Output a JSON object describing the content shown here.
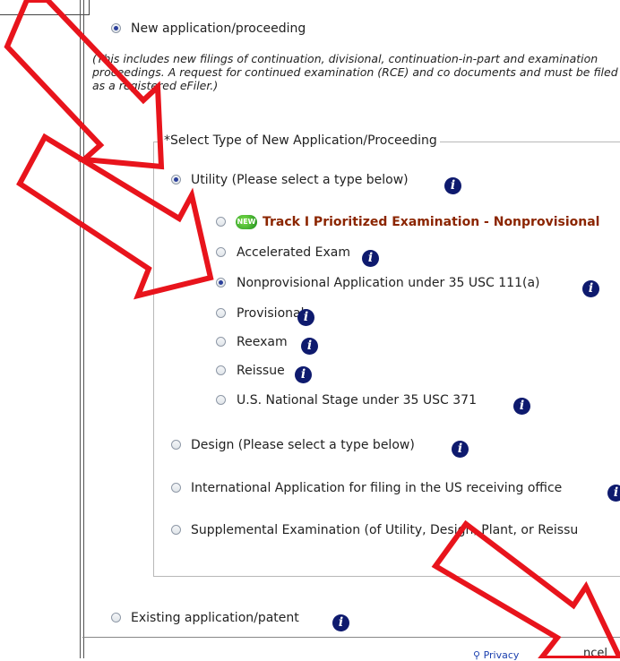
{
  "application": {
    "new_label": "New application/proceeding",
    "note": "(This includes new filings of continuation, divisional, continuation-in-part and examination proceedings. A request for continued examination (RCE) and co documents and must be filed as a registered eFiler.)",
    "type_legend": "*Select Type of New Application/Proceeding",
    "utility_label": "Utility (Please select a type below)",
    "utility_types": [
      {
        "label": "Track I Prioritized Examination - Nonprovisional",
        "badge": "NEW"
      },
      {
        "label": "Accelerated Exam"
      },
      {
        "label": "Nonprovisional Application under 35 USC 111(a)"
      },
      {
        "label": "Provisional"
      },
      {
        "label": "Reexam"
      },
      {
        "label": "Reissue"
      },
      {
        "label": "U.S. National Stage under 35 USC 371"
      }
    ],
    "design_label": "Design (Please select a type below)",
    "international_label": "International Application for filing in the US receiving office",
    "supplemental_label": "Supplemental Examination (of Utility, Design, Plant, or Reissu",
    "existing_label": "Existing application/patent",
    "selected_application": "new",
    "selected_type": "utility",
    "selected_utility_type": "Nonprovisional Application under 35 USC 111(a)"
  },
  "footer": {
    "privacy_link": "Privacy",
    "cancel_partial": "ncel"
  },
  "colors": {
    "annotation_red": "#e8141c",
    "info_icon": "#0e1a6e",
    "track_text": "#8b2500",
    "radio_dot": "#2b3f9b"
  },
  "icons": [
    "info-icon",
    "new-badge-icon",
    "red-arrow-annotation"
  ]
}
